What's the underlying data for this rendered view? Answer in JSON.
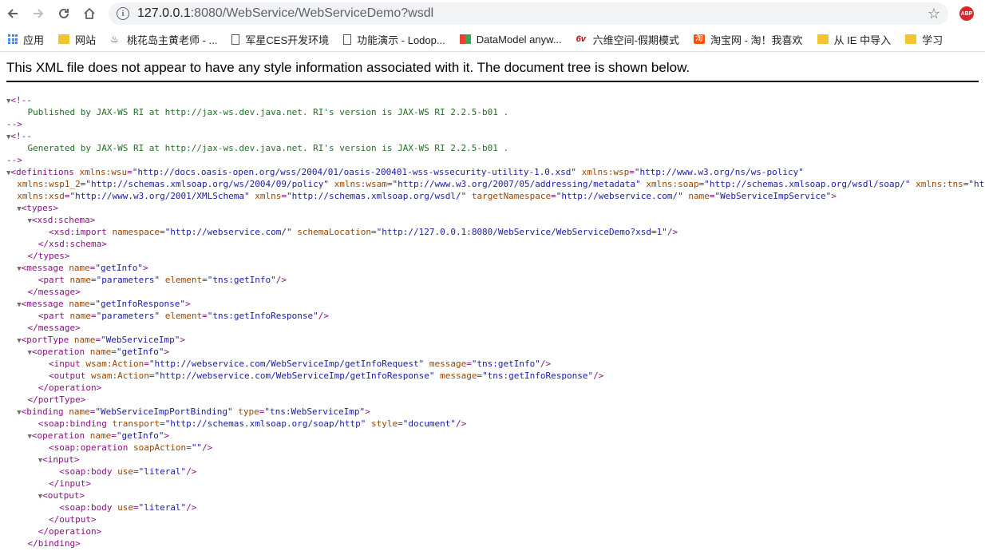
{
  "browser": {
    "url_host": "127.0.0.1",
    "url_rest": ":8080/WebService/WebServiceDemo?wsdl",
    "abp_label": "ABP",
    "bookmarks": [
      {
        "label": "应用",
        "icon": "apps-icon"
      },
      {
        "label": "网站",
        "icon": "folder-icon"
      },
      {
        "label": "桃花岛主黄老师 - ...",
        "icon": "peach-icon"
      },
      {
        "label": "军星CES开发环境",
        "icon": "page-icon"
      },
      {
        "label": "功能演示 - Lodop...",
        "icon": "page-icon"
      },
      {
        "label": "DataModel anyw...",
        "icon": "datamodel-icon"
      },
      {
        "label": "六维空间-假期模式",
        "icon": "six-icon"
      },
      {
        "label": "淘宝网 - 淘！我喜欢",
        "icon": "taobao-icon"
      },
      {
        "label": "从 IE 中导入",
        "icon": "folder-icon"
      },
      {
        "label": "学习",
        "icon": "folder-icon"
      }
    ]
  },
  "notice": "This XML file does not appear to have any style information associated with it. The document tree is shown below.",
  "xml_lines": [
    [
      [
        "t",
        "▼"
      ],
      [
        "p",
        "<!--"
      ]
    ],
    [
      [
        "c",
        "    Published by JAX-WS RI at http://jax-ws.dev.java.net. RI's version is JAX-WS RI 2.2.5-b01 ."
      ]
    ],
    [
      [
        "p",
        "-->"
      ]
    ],
    [
      [
        "t",
        "▼"
      ],
      [
        "p",
        "<!--"
      ]
    ],
    [
      [
        "c",
        "    Generated by JAX-WS RI at http://jax-ws.dev.java.net. RI's version is JAX-WS RI 2.2.5-b01 ."
      ]
    ],
    [
      [
        "p",
        "-->"
      ]
    ],
    [
      [
        "t",
        "▼"
      ],
      [
        "p",
        "<definitions "
      ],
      [
        "a",
        "xmlns:wsu"
      ],
      [
        "p",
        "="
      ],
      [
        "v",
        "\"http://docs.oasis-open.org/wss/2004/01/oasis-200401-wss-wssecurity-utility-1.0.xsd\""
      ],
      [
        "p",
        " "
      ],
      [
        "a",
        "xmlns:wsp"
      ],
      [
        "p",
        "="
      ],
      [
        "v",
        "\"http://www.w3.org/ns/ws-policy\""
      ]
    ],
    [
      [
        "p",
        "  "
      ],
      [
        "a",
        "xmlns:wsp1_2"
      ],
      [
        "p",
        "="
      ],
      [
        "v",
        "\"http://schemas.xmlsoap.org/ws/2004/09/policy\""
      ],
      [
        "p",
        " "
      ],
      [
        "a",
        "xmlns:wsam"
      ],
      [
        "p",
        "="
      ],
      [
        "v",
        "\"http://www.w3.org/2007/05/addressing/metadata\""
      ],
      [
        "p",
        " "
      ],
      [
        "a",
        "xmlns:soap"
      ],
      [
        "p",
        "="
      ],
      [
        "v",
        "\"http://schemas.xmlsoap.org/wsdl/soap/\""
      ],
      [
        "p",
        " "
      ],
      [
        "a",
        "xmlns:tns"
      ],
      [
        "p",
        "="
      ],
      [
        "v",
        "\"http://"
      ]
    ],
    [
      [
        "p",
        "  "
      ],
      [
        "a",
        "xmlns:xsd"
      ],
      [
        "p",
        "="
      ],
      [
        "v",
        "\"http://www.w3.org/2001/XMLSchema\""
      ],
      [
        "p",
        " "
      ],
      [
        "a",
        "xmlns"
      ],
      [
        "p",
        "="
      ],
      [
        "v",
        "\"http://schemas.xmlsoap.org/wsdl/\""
      ],
      [
        "p",
        " "
      ],
      [
        "a",
        "targetNamespace"
      ],
      [
        "p",
        "="
      ],
      [
        "v",
        "\"http://webservice.com/\""
      ],
      [
        "p",
        " "
      ],
      [
        "a",
        "name"
      ],
      [
        "p",
        "="
      ],
      [
        "v",
        "\"WebServiceImpService\""
      ],
      [
        "p",
        ">"
      ]
    ],
    [
      [
        "p",
        "  "
      ],
      [
        "t",
        "▼"
      ],
      [
        "p",
        "<types>"
      ]
    ],
    [
      [
        "p",
        "    "
      ],
      [
        "t",
        "▼"
      ],
      [
        "p",
        "<xsd:schema>"
      ]
    ],
    [
      [
        "p",
        "        <xsd:import "
      ],
      [
        "a",
        "namespace"
      ],
      [
        "p",
        "="
      ],
      [
        "v",
        "\"http://webservice.com/\""
      ],
      [
        "p",
        " "
      ],
      [
        "a",
        "schemaLocation"
      ],
      [
        "p",
        "="
      ],
      [
        "v",
        "\"http://127.0.0.1:8080/WebService/WebServiceDemo?xsd=1\""
      ],
      [
        "p",
        "/>"
      ]
    ],
    [
      [
        "p",
        "      </xsd:schema>"
      ]
    ],
    [
      [
        "p",
        "    </types>"
      ]
    ],
    [
      [
        "p",
        "  "
      ],
      [
        "t",
        "▼"
      ],
      [
        "p",
        "<message "
      ],
      [
        "a",
        "name"
      ],
      [
        "p",
        "="
      ],
      [
        "v",
        "\"getInfo\""
      ],
      [
        "p",
        ">"
      ]
    ],
    [
      [
        "p",
        "      <part "
      ],
      [
        "a",
        "name"
      ],
      [
        "p",
        "="
      ],
      [
        "v",
        "\"parameters\""
      ],
      [
        "p",
        " "
      ],
      [
        "a",
        "element"
      ],
      [
        "p",
        "="
      ],
      [
        "v",
        "\"tns:getInfo\""
      ],
      [
        "p",
        "/>"
      ]
    ],
    [
      [
        "p",
        "    </message>"
      ]
    ],
    [
      [
        "p",
        "  "
      ],
      [
        "t",
        "▼"
      ],
      [
        "p",
        "<message "
      ],
      [
        "a",
        "name"
      ],
      [
        "p",
        "="
      ],
      [
        "v",
        "\"getInfoResponse\""
      ],
      [
        "p",
        ">"
      ]
    ],
    [
      [
        "p",
        "      <part "
      ],
      [
        "a",
        "name"
      ],
      [
        "p",
        "="
      ],
      [
        "v",
        "\"parameters\""
      ],
      [
        "p",
        " "
      ],
      [
        "a",
        "element"
      ],
      [
        "p",
        "="
      ],
      [
        "v",
        "\"tns:getInfoResponse\""
      ],
      [
        "p",
        "/>"
      ]
    ],
    [
      [
        "p",
        "    </message>"
      ]
    ],
    [
      [
        "p",
        "  "
      ],
      [
        "t",
        "▼"
      ],
      [
        "p",
        "<portType "
      ],
      [
        "a",
        "name"
      ],
      [
        "p",
        "="
      ],
      [
        "v",
        "\"WebServiceImp\""
      ],
      [
        "p",
        ">"
      ]
    ],
    [
      [
        "p",
        "    "
      ],
      [
        "t",
        "▼"
      ],
      [
        "p",
        "<operation "
      ],
      [
        "a",
        "name"
      ],
      [
        "p",
        "="
      ],
      [
        "v",
        "\"getInfo\""
      ],
      [
        "p",
        ">"
      ]
    ],
    [
      [
        "p",
        "        <input "
      ],
      [
        "a",
        "wsam:Action"
      ],
      [
        "p",
        "="
      ],
      [
        "v",
        "\"http://webservice.com/WebServiceImp/getInfoRequest\""
      ],
      [
        "p",
        " "
      ],
      [
        "a",
        "message"
      ],
      [
        "p",
        "="
      ],
      [
        "v",
        "\"tns:getInfo\""
      ],
      [
        "p",
        "/>"
      ]
    ],
    [
      [
        "p",
        "        <output "
      ],
      [
        "a",
        "wsam:Action"
      ],
      [
        "p",
        "="
      ],
      [
        "v",
        "\"http://webservice.com/WebServiceImp/getInfoResponse\""
      ],
      [
        "p",
        " "
      ],
      [
        "a",
        "message"
      ],
      [
        "p",
        "="
      ],
      [
        "v",
        "\"tns:getInfoResponse\""
      ],
      [
        "p",
        "/>"
      ]
    ],
    [
      [
        "p",
        "      </operation>"
      ]
    ],
    [
      [
        "p",
        "    </portType>"
      ]
    ],
    [
      [
        "p",
        "  "
      ],
      [
        "t",
        "▼"
      ],
      [
        "p",
        "<binding "
      ],
      [
        "a",
        "name"
      ],
      [
        "p",
        "="
      ],
      [
        "v",
        "\"WebServiceImpPortBinding\""
      ],
      [
        "p",
        " "
      ],
      [
        "a",
        "type"
      ],
      [
        "p",
        "="
      ],
      [
        "v",
        "\"tns:WebServiceImp\""
      ],
      [
        "p",
        ">"
      ]
    ],
    [
      [
        "p",
        "      <soap:binding "
      ],
      [
        "a",
        "transport"
      ],
      [
        "p",
        "="
      ],
      [
        "v",
        "\"http://schemas.xmlsoap.org/soap/http\""
      ],
      [
        "p",
        " "
      ],
      [
        "a",
        "style"
      ],
      [
        "p",
        "="
      ],
      [
        "v",
        "\"document\""
      ],
      [
        "p",
        "/>"
      ]
    ],
    [
      [
        "p",
        "    "
      ],
      [
        "t",
        "▼"
      ],
      [
        "p",
        "<operation "
      ],
      [
        "a",
        "name"
      ],
      [
        "p",
        "="
      ],
      [
        "v",
        "\"getInfo\""
      ],
      [
        "p",
        ">"
      ]
    ],
    [
      [
        "p",
        "        <soap:operation "
      ],
      [
        "a",
        "soapAction"
      ],
      [
        "p",
        "="
      ],
      [
        "v",
        "\"\""
      ],
      [
        "p",
        "/>"
      ]
    ],
    [
      [
        "p",
        "      "
      ],
      [
        "t",
        "▼"
      ],
      [
        "p",
        "<input>"
      ]
    ],
    [
      [
        "p",
        "          <soap:body "
      ],
      [
        "a",
        "use"
      ],
      [
        "p",
        "="
      ],
      [
        "v",
        "\"literal\""
      ],
      [
        "p",
        "/>"
      ]
    ],
    [
      [
        "p",
        "        </input>"
      ]
    ],
    [
      [
        "p",
        "      "
      ],
      [
        "t",
        "▼"
      ],
      [
        "p",
        "<output>"
      ]
    ],
    [
      [
        "p",
        "          <soap:body "
      ],
      [
        "a",
        "use"
      ],
      [
        "p",
        "="
      ],
      [
        "v",
        "\"literal\""
      ],
      [
        "p",
        "/>"
      ]
    ],
    [
      [
        "p",
        "        </output>"
      ]
    ],
    [
      [
        "p",
        "      </operation>"
      ]
    ],
    [
      [
        "p",
        "    </binding>"
      ]
    ]
  ]
}
